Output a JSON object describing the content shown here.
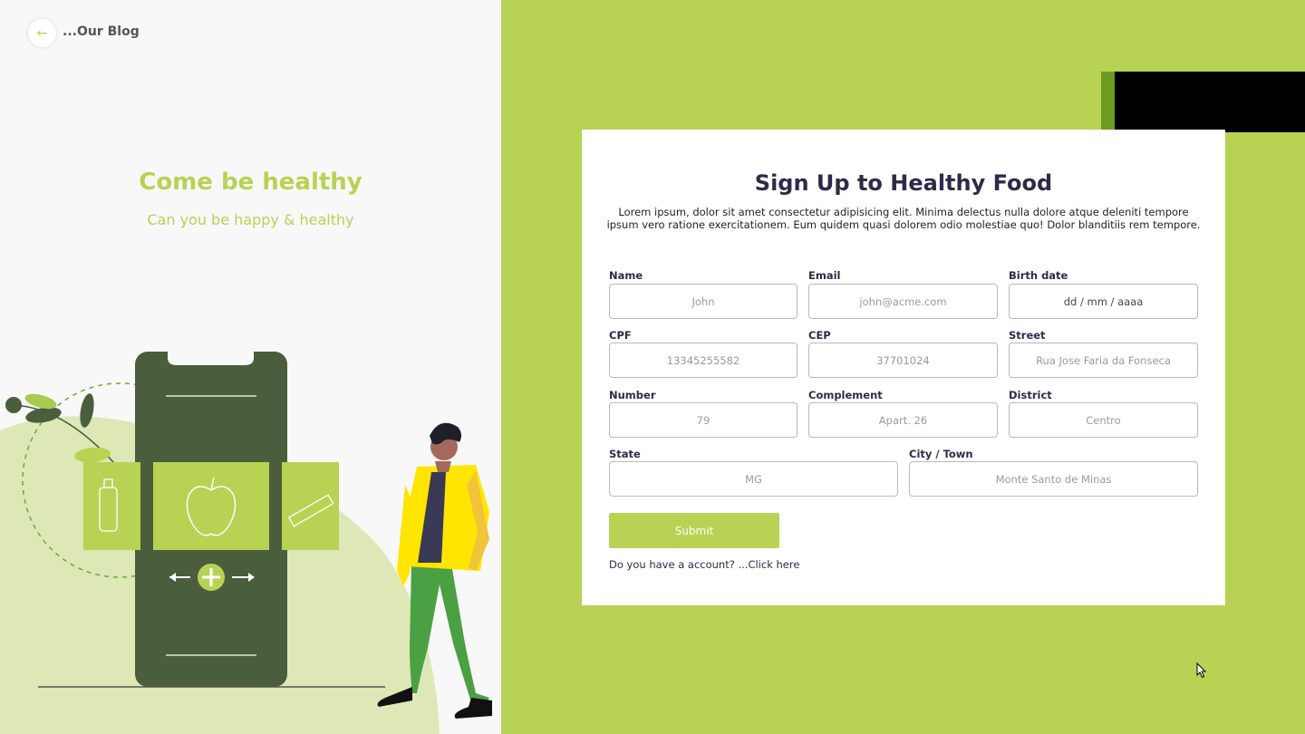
{
  "nav": {
    "back_label": "...Our Blog",
    "back_icon": "arrow-left-icon"
  },
  "hero": {
    "title": "Come be healthy",
    "subtitle": "Can you be happy & healthy"
  },
  "colors": {
    "accent": "#b8d253",
    "dark_green": "#4a5e3d",
    "card_bg": "#ffffff",
    "text_dark": "#2c2c4a"
  },
  "form": {
    "title": "Sign Up to Healthy Food",
    "description": "Lorem ipsum, dolor sit amet consectetur adipisicing elit. Minima delectus nulla dolore atque deleniti tempore ipsum vero ratione exercitationem. Eum quidem quasi dolorem odio molestiae quo! Dolor blanditiis rem tempore.",
    "fields": {
      "name": {
        "label": "Name",
        "placeholder": "John"
      },
      "email": {
        "label": "Email",
        "placeholder": "john@acme.com"
      },
      "birth": {
        "label": "Birth date",
        "value": "dd / mm / aaaa"
      },
      "cpf": {
        "label": "CPF",
        "placeholder": "13345255582"
      },
      "cep": {
        "label": "CEP",
        "placeholder": "37701024"
      },
      "street": {
        "label": "Street",
        "placeholder": "Rua Jose Faria da Fonseca"
      },
      "number": {
        "label": "Number",
        "placeholder": "79"
      },
      "complement": {
        "label": "Complement",
        "placeholder": "Apart. 26"
      },
      "district": {
        "label": "District",
        "placeholder": "Centro"
      },
      "state": {
        "label": "State",
        "placeholder": "MG"
      },
      "city": {
        "label": "City / Town",
        "placeholder": "Monte Santo de Minas"
      }
    },
    "submit_label": "Submit",
    "account_prompt": "Do you have a account?",
    "account_link": "...Click here"
  }
}
